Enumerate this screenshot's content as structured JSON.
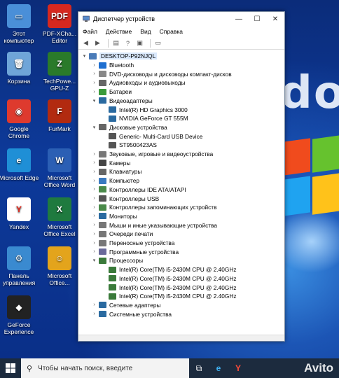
{
  "desktop": {
    "wallpaper_text": "do",
    "icons": [
      {
        "label": "Этот компьютер",
        "icon": "computer-icon",
        "color": "#4a8fd8",
        "symbol": "▭"
      },
      {
        "label": "PDF-XCha... Editor",
        "icon": "pdf-xchange-icon",
        "color": "#d6281f",
        "symbol": "PDF"
      },
      {
        "label": "Корзина",
        "icon": "recycle-bin-icon",
        "color": "#6fa5d8",
        "symbol": "🗑"
      },
      {
        "label": "TechPowe... GPU-Z",
        "icon": "gpu-z-icon",
        "color": "#2a7a2a",
        "symbol": "Z"
      },
      {
        "label": "Google Chrome",
        "icon": "chrome-icon",
        "color": "#de3a2e",
        "symbol": "◉"
      },
      {
        "label": "FurMark",
        "icon": "furmark-icon",
        "color": "#b22a10",
        "symbol": "F"
      },
      {
        "label": "Microsoft Edge",
        "icon": "edge-icon",
        "color": "#1f8fd6",
        "symbol": "e"
      },
      {
        "label": "Microsoft Office Word",
        "icon": "word-icon",
        "color": "#2b5fb4",
        "symbol": "W"
      },
      {
        "label": "Yandex",
        "icon": "yandex-icon",
        "color": "#ffffff",
        "symbol": "Y"
      },
      {
        "label": "Microsoft Office Excel",
        "icon": "excel-icon",
        "color": "#1f7a3f",
        "symbol": "X"
      },
      {
        "label": "Панель управления",
        "icon": "control-panel-icon",
        "color": "#3a8ad0",
        "symbol": "⚙"
      },
      {
        "label": "Microsoft Office...",
        "icon": "outlook-icon",
        "color": "#e3a41c",
        "symbol": "☺"
      },
      {
        "label": "GeForce Experience",
        "icon": "geforce-icon",
        "color": "#222222",
        "symbol": "◆"
      }
    ]
  },
  "window": {
    "title": "Диспетчер устройств",
    "menu": [
      "Файл",
      "Действие",
      "Вид",
      "Справка"
    ],
    "controls": {
      "minimize": "—",
      "maximize": "☐",
      "close": "✕"
    },
    "tree": [
      {
        "level": 0,
        "arrow": "▾",
        "label": "DESKTOP-P92NJQL",
        "icon": "computer-icon",
        "color": "#4a7bb8",
        "root": true
      },
      {
        "level": 1,
        "arrow": "›",
        "label": "Bluetooth",
        "icon": "bluetooth-icon",
        "color": "#1f6fd0"
      },
      {
        "level": 1,
        "arrow": "›",
        "label": "DVD-дисководы и дисководы компакт-дисков",
        "icon": "dvd-drive-icon",
        "color": "#888888"
      },
      {
        "level": 1,
        "arrow": "›",
        "label": "Аудиовходы и аудиовыходы",
        "icon": "audio-icon",
        "color": "#666666"
      },
      {
        "level": 1,
        "arrow": "›",
        "label": "Батареи",
        "icon": "battery-icon",
        "color": "#3a9a3a"
      },
      {
        "level": 1,
        "arrow": "▾",
        "label": "Видеоадаптеры",
        "icon": "display-adapter-icon",
        "color": "#2a6aa0"
      },
      {
        "level": 2,
        "arrow": "",
        "label": "Intel(R) HD Graphics 3000",
        "icon": "display-adapter-icon",
        "color": "#2a6aa0"
      },
      {
        "level": 2,
        "arrow": "",
        "label": "NVIDIA GeForce GT 555M",
        "icon": "display-adapter-icon",
        "color": "#2a6aa0"
      },
      {
        "level": 1,
        "arrow": "▾",
        "label": "Дисковые устройства",
        "icon": "disk-drive-icon",
        "color": "#666666"
      },
      {
        "level": 2,
        "arrow": "",
        "label": "Generic- Multi-Card USB Device",
        "icon": "disk-drive-icon",
        "color": "#555555"
      },
      {
        "level": 2,
        "arrow": "",
        "label": "ST9500423AS",
        "icon": "disk-drive-icon",
        "color": "#555555"
      },
      {
        "level": 1,
        "arrow": "›",
        "label": "Звуковые, игровые и видеоустройства",
        "icon": "sound-icon",
        "color": "#777777"
      },
      {
        "level": 1,
        "arrow": "›",
        "label": "Камеры",
        "icon": "camera-icon",
        "color": "#444444"
      },
      {
        "level": 1,
        "arrow": "›",
        "label": "Клавиатуры",
        "icon": "keyboard-icon",
        "color": "#666666"
      },
      {
        "level": 1,
        "arrow": "›",
        "label": "Компьютер",
        "icon": "computer-icon",
        "color": "#3a7ac0"
      },
      {
        "level": 1,
        "arrow": "›",
        "label": "Контроллеры IDE ATA/ATAPI",
        "icon": "ide-controller-icon",
        "color": "#4a8a4a"
      },
      {
        "level": 1,
        "arrow": "›",
        "label": "Контроллеры USB",
        "icon": "usb-icon",
        "color": "#555555"
      },
      {
        "level": 1,
        "arrow": "›",
        "label": "Контроллеры запоминающих устройств",
        "icon": "storage-controller-icon",
        "color": "#4a8a4a"
      },
      {
        "level": 1,
        "arrow": "›",
        "label": "Мониторы",
        "icon": "monitor-icon",
        "color": "#2a6aa0"
      },
      {
        "level": 1,
        "arrow": "›",
        "label": "Мыши и иные указывающие устройства",
        "icon": "mouse-icon",
        "color": "#777777"
      },
      {
        "level": 1,
        "arrow": "›",
        "label": "Очереди печати",
        "icon": "print-queue-icon",
        "color": "#777777"
      },
      {
        "level": 1,
        "arrow": "›",
        "label": "Переносные устройства",
        "icon": "portable-device-icon",
        "color": "#777777"
      },
      {
        "level": 1,
        "arrow": "›",
        "label": "Программные устройства",
        "icon": "software-device-icon",
        "color": "#6a6a9a"
      },
      {
        "level": 1,
        "arrow": "▾",
        "label": "Процессоры",
        "icon": "processor-icon",
        "color": "#3a7a3a"
      },
      {
        "level": 2,
        "arrow": "",
        "label": "Intel(R) Core(TM) i5-2430M CPU @ 2.40GHz",
        "icon": "processor-icon",
        "color": "#3a7a3a"
      },
      {
        "level": 2,
        "arrow": "",
        "label": "Intel(R) Core(TM) i5-2430M CPU @ 2.40GHz",
        "icon": "processor-icon",
        "color": "#3a7a3a"
      },
      {
        "level": 2,
        "arrow": "",
        "label": "Intel(R) Core(TM) i5-2430M CPU @ 2.40GHz",
        "icon": "processor-icon",
        "color": "#3a7a3a"
      },
      {
        "level": 2,
        "arrow": "",
        "label": "Intel(R) Core(TM) i5-2430M CPU @ 2.40GHz",
        "icon": "processor-icon",
        "color": "#3a7a3a"
      },
      {
        "level": 1,
        "arrow": "›",
        "label": "Сетевые адаптеры",
        "icon": "network-adapter-icon",
        "color": "#2a6aa0"
      },
      {
        "level": 1,
        "arrow": "›",
        "label": "Системные устройства",
        "icon": "system-device-icon",
        "color": "#2a6aa0"
      }
    ]
  },
  "taskbar": {
    "search_placeholder": "Чтобы начать поиск, введите",
    "watermark": "Avito"
  }
}
